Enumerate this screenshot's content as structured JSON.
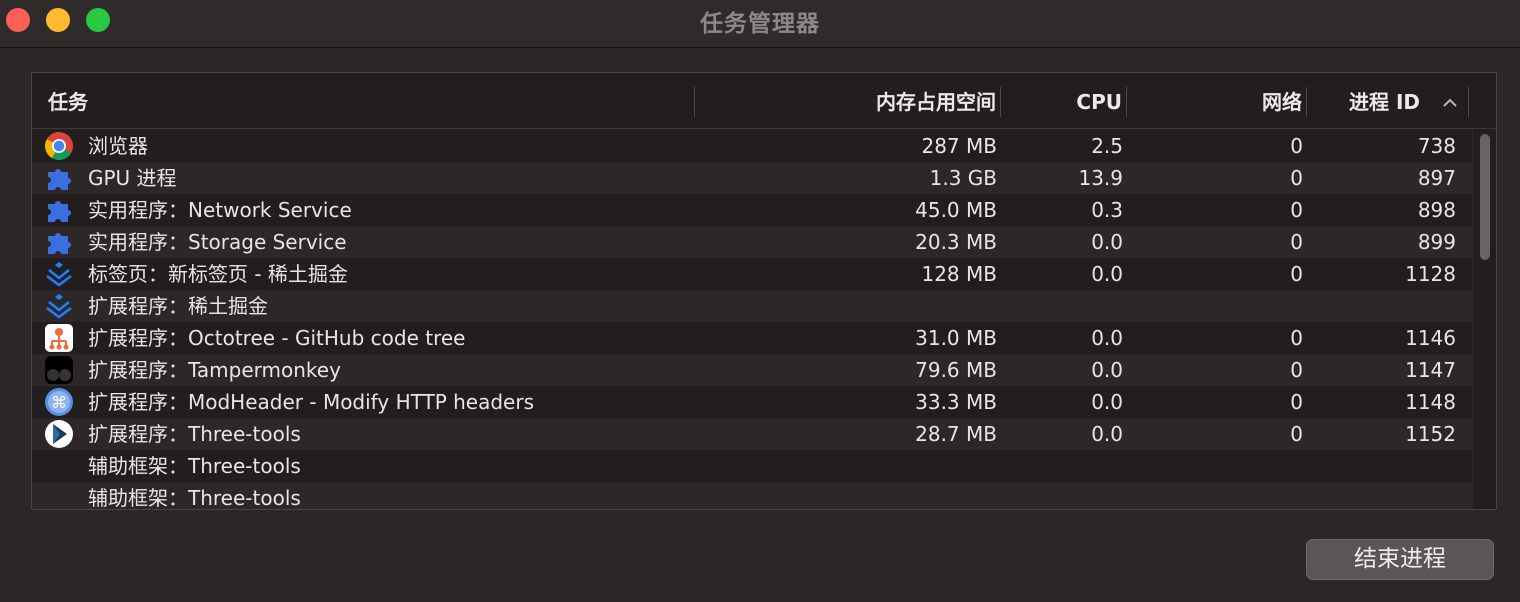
{
  "window": {
    "title": "任务管理器"
  },
  "table": {
    "headers": {
      "task": "任务",
      "memory": "内存占用空间",
      "cpu": "CPU",
      "network": "网络",
      "pid": "进程 ID"
    },
    "rows": [
      {
        "icon": "chrome-icon",
        "name": "浏览器",
        "memory": "287 MB",
        "cpu": "2.5",
        "network": "0",
        "pid": "738"
      },
      {
        "icon": "puzzle-icon",
        "name": "GPU 进程",
        "memory": "1.3 GB",
        "cpu": "13.9",
        "network": "0",
        "pid": "897"
      },
      {
        "icon": "puzzle-icon",
        "name": "实用程序：Network Service",
        "memory": "45.0 MB",
        "cpu": "0.3",
        "network": "0",
        "pid": "898"
      },
      {
        "icon": "puzzle-icon",
        "name": "实用程序：Storage Service",
        "memory": "20.3 MB",
        "cpu": "0.0",
        "network": "0",
        "pid": "899"
      },
      {
        "icon": "juejin-icon",
        "name": "标签页：新标签页 - 稀土掘金",
        "memory": "128 MB",
        "cpu": "0.0",
        "network": "0",
        "pid": "1128"
      },
      {
        "icon": "juejin-icon",
        "name": "扩展程序：稀土掘金",
        "memory": "",
        "cpu": "",
        "network": "",
        "pid": ""
      },
      {
        "icon": "octotree-icon",
        "name": "扩展程序：Octotree - GitHub code tree",
        "memory": "31.0 MB",
        "cpu": "0.0",
        "network": "0",
        "pid": "1146"
      },
      {
        "icon": "tampermonkey-icon",
        "name": "扩展程序：Tampermonkey",
        "memory": "79.6 MB",
        "cpu": "0.0",
        "network": "0",
        "pid": "1147"
      },
      {
        "icon": "modheader-icon",
        "name": "扩展程序：ModHeader - Modify HTTP headers",
        "memory": "33.3 MB",
        "cpu": "0.0",
        "network": "0",
        "pid": "1148"
      },
      {
        "icon": "threetools-icon",
        "name": "扩展程序：Three-tools",
        "memory": "28.7 MB",
        "cpu": "0.0",
        "network": "0",
        "pid": "1152"
      },
      {
        "icon": "",
        "name": "辅助框架：Three-tools",
        "memory": "",
        "cpu": "",
        "network": "",
        "pid": ""
      },
      {
        "icon": "",
        "name": "辅助框架：Three-tools",
        "memory": "",
        "cpu": "",
        "network": "",
        "pid": ""
      }
    ]
  },
  "actions": {
    "end_process": "结束进程"
  },
  "colors": {
    "background": "#2b2726",
    "row_alt": "#2d2827",
    "accent_blue": "#3b6fe0"
  }
}
